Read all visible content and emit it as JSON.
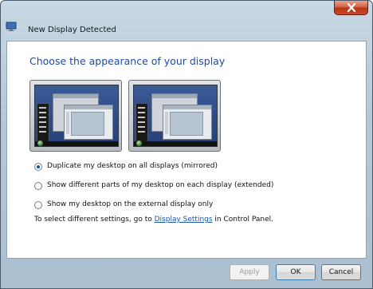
{
  "window": {
    "title": "New Display Detected"
  },
  "main": {
    "heading": "Choose the appearance of your display",
    "options": [
      {
        "label": "Duplicate my desktop on all displays (mirrored)",
        "selected": true
      },
      {
        "label": "Show different parts of my desktop on each display (extended)",
        "selected": false
      },
      {
        "label": "Show my desktop on the external display only",
        "selected": false
      }
    ],
    "info": {
      "prefix": "To select different settings, go to ",
      "link": "Display Settings",
      "suffix": " in Control Panel."
    }
  },
  "buttons": {
    "apply": "Apply",
    "ok": "OK",
    "cancel": "Cancel"
  },
  "icons": {
    "title": "display-icon",
    "close": "close-icon",
    "start": "start-orb-icon"
  },
  "colors": {
    "heading": "#1e4aa0",
    "link": "#1c55b4",
    "close": "#c9482b"
  }
}
